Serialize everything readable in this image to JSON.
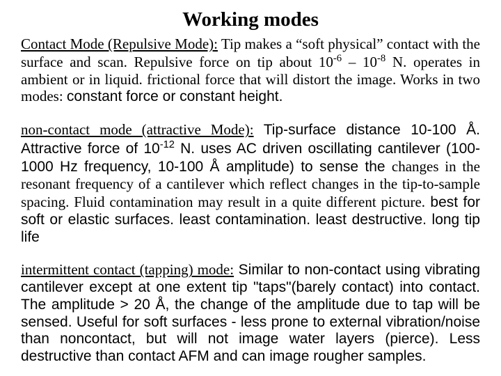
{
  "title": "Working modes",
  "p1_lead": "Contact Mode (Repulsive Mode):",
  "p1_a": " Tip makes a “soft physical” contact with the surface and scan. Repulsive force on tip about 10",
  "p1_sup1": "-6",
  "p1_b": " – 10",
  "p1_sup2": "-8",
  "p1_c": " N. operates in ambient or in liquid. frictional force that will distort the image. Works in two modes: ",
  "p1_d": "constant force or constant height.",
  "p2_lead": "non-contact mode (attractive Mode):",
  "p2_a": " Tip-surface distance 10‑100 Å. Attractive force of 10",
  "p2_sup": "-12",
  "p2_b": " N. uses AC driven oscillating cantilever (100-1000 Hz frequency, 10-100 Å amplitude) to sense the ",
  "p2_c": "changes in the resonant frequency of a cantilever which reflect changes in the tip-to-sample spacing. Fluid contamination may result in a quite different picture.",
  "p2_d": " best for soft or elastic surfaces. least contamination. least destructive. long tip life",
  "p3_lead": "intermittent contact (tapping) mode:",
  "p3_a": " Similar to non-contact using vibrating cantilever except at one extent tip \"taps\"(barely contact)  into contact. The amplitude > 20 Å, the change of the amplitude due to tap will be sensed. Useful for soft surfaces - less prone to external vibration/noise than noncontact, but will not image water layers (pierce). Less destructive than contact AFM and can image rougher samples."
}
